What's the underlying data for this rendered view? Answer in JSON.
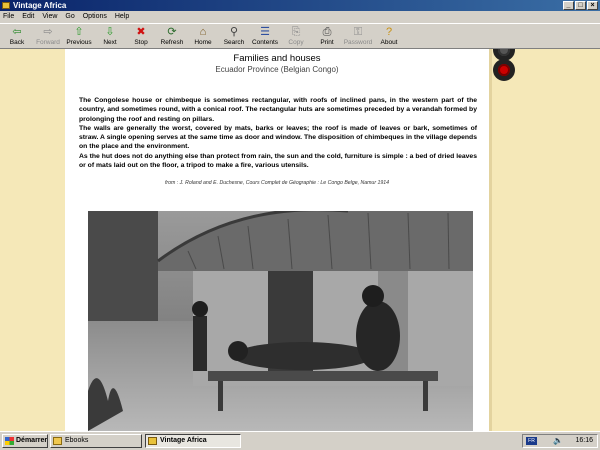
{
  "window": {
    "title": "Vintage Africa"
  },
  "menu": [
    "File",
    "Edit",
    "View",
    "Go",
    "Options",
    "Help"
  ],
  "toolbar": [
    {
      "label": "Back",
      "icon": "⇦",
      "color": "#2a8a2a",
      "enabled": true
    },
    {
      "label": "Forward",
      "icon": "⇨",
      "color": "#8a8a8a",
      "enabled": false
    },
    {
      "label": "Previous",
      "icon": "⇧",
      "color": "#2a9a2a",
      "enabled": true
    },
    {
      "label": "Next",
      "icon": "⇩",
      "color": "#2a9a2a",
      "enabled": true
    },
    {
      "label": "Stop",
      "icon": "✖",
      "color": "#d01010",
      "enabled": true
    },
    {
      "label": "Refresh",
      "icon": "⟳",
      "color": "#2a6a2a",
      "enabled": true
    },
    {
      "label": "Home",
      "icon": "⌂",
      "color": "#7a5a20",
      "enabled": true
    },
    {
      "label": "Search",
      "icon": "⚲",
      "color": "#404040",
      "enabled": true
    },
    {
      "label": "Contents",
      "icon": "☰",
      "color": "#3050a0",
      "enabled": true
    },
    {
      "label": "Copy",
      "icon": "⎘",
      "color": "#8a8a8a",
      "enabled": false
    },
    {
      "label": "Print",
      "icon": "⎙",
      "color": "#404040",
      "enabled": true
    },
    {
      "label": "Password",
      "icon": "⚿",
      "color": "#8a8a8a",
      "enabled": false
    },
    {
      "label": "About",
      "icon": "?",
      "color": "#c89010",
      "enabled": true
    }
  ],
  "page": {
    "title": "Families and houses",
    "subtitle": "Ecuador Province (Belgian Congo)",
    "paragraphs": [
      "The Congolese house or chimbeque is sometimes rectangular, with roofs of inclined pans, in the western part of the country, and sometimes round, with a conical roof. The rectangular huts are sometimes preceded by a verandah formed by prolonging the roof and resting on pillars.",
      "The walls are generally the worst, covered by mats, barks or leaves; the roof is made of leaves or bark, sometimes of straw. A single opening serves at the same time as door and window. The disposition of chimbeques in the village depends on the place and the environment.",
      "As the hut does not do anything else than protect from rain, the sun and the cold, furniture is simple : a bed of dried leaves or of mats laid out on the floor, a tripod to make a fire, various utensils."
    ],
    "source": "from : J. Roland and E. Duchesne, Cours Complet de Géographie : Le Congo Belge, Namur 1914"
  },
  "taskbar": {
    "start": "Démarrer",
    "tasks": [
      "Ebooks",
      "Vintage Africa"
    ],
    "lang": "FR",
    "clock": "16:16"
  }
}
